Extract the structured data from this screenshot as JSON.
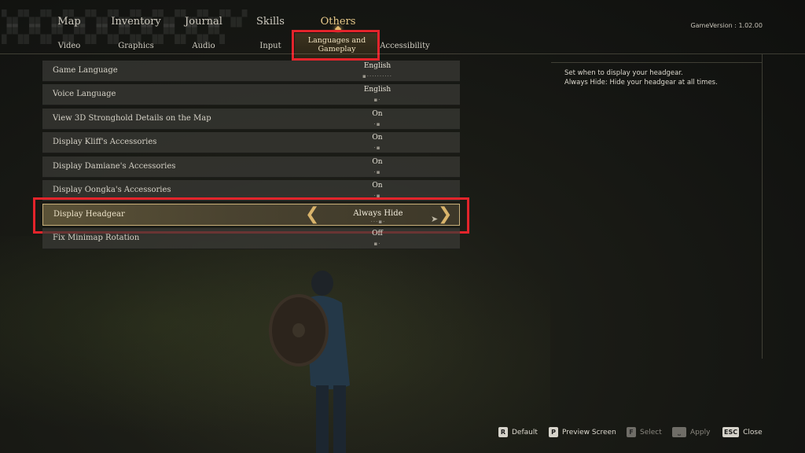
{
  "top_tabs": [
    {
      "label": "Map"
    },
    {
      "label": "Inventory"
    },
    {
      "label": "Journal"
    },
    {
      "label": "Skills"
    },
    {
      "label": "Others"
    }
  ],
  "version": "GameVersion : 1.02.00",
  "sub_tabs": [
    {
      "label": "Video"
    },
    {
      "label": "Graphics"
    },
    {
      "label": "Audio"
    },
    {
      "label": "Input"
    },
    {
      "label": "Languages and"
    },
    {
      "label": "Gameplay"
    },
    {
      "label": "Accessibility"
    }
  ],
  "settings": [
    {
      "label": "Game Language",
      "value": "English"
    },
    {
      "label": "Voice Language",
      "value": "English"
    },
    {
      "label": "View 3D Stronghold Details on the Map",
      "value": "On"
    },
    {
      "label": "Display Kliff's Accessories",
      "value": "On"
    },
    {
      "label": "Display Damiane's Accessories",
      "value": "On"
    },
    {
      "label": "Display Oongka's Accessories",
      "value": "On"
    },
    {
      "label": "Display Headgear",
      "value": "Always Hide"
    },
    {
      "label": "Fix Minimap Rotation",
      "value": "Off"
    }
  ],
  "description": {
    "line1": "Set when to display your headgear.",
    "line2": "Always Hide: Hide your headgear at all times."
  },
  "hints": [
    {
      "key": "R",
      "label": "Default"
    },
    {
      "key": "P",
      "label": "Preview Screen"
    },
    {
      "key": "F",
      "label": "Select"
    },
    {
      "key": "⎵",
      "label": "Apply"
    },
    {
      "key": "ESC",
      "label": "Close"
    }
  ],
  "colors": {
    "accent": "#d0a559",
    "highlight_box": "#e3242b"
  }
}
